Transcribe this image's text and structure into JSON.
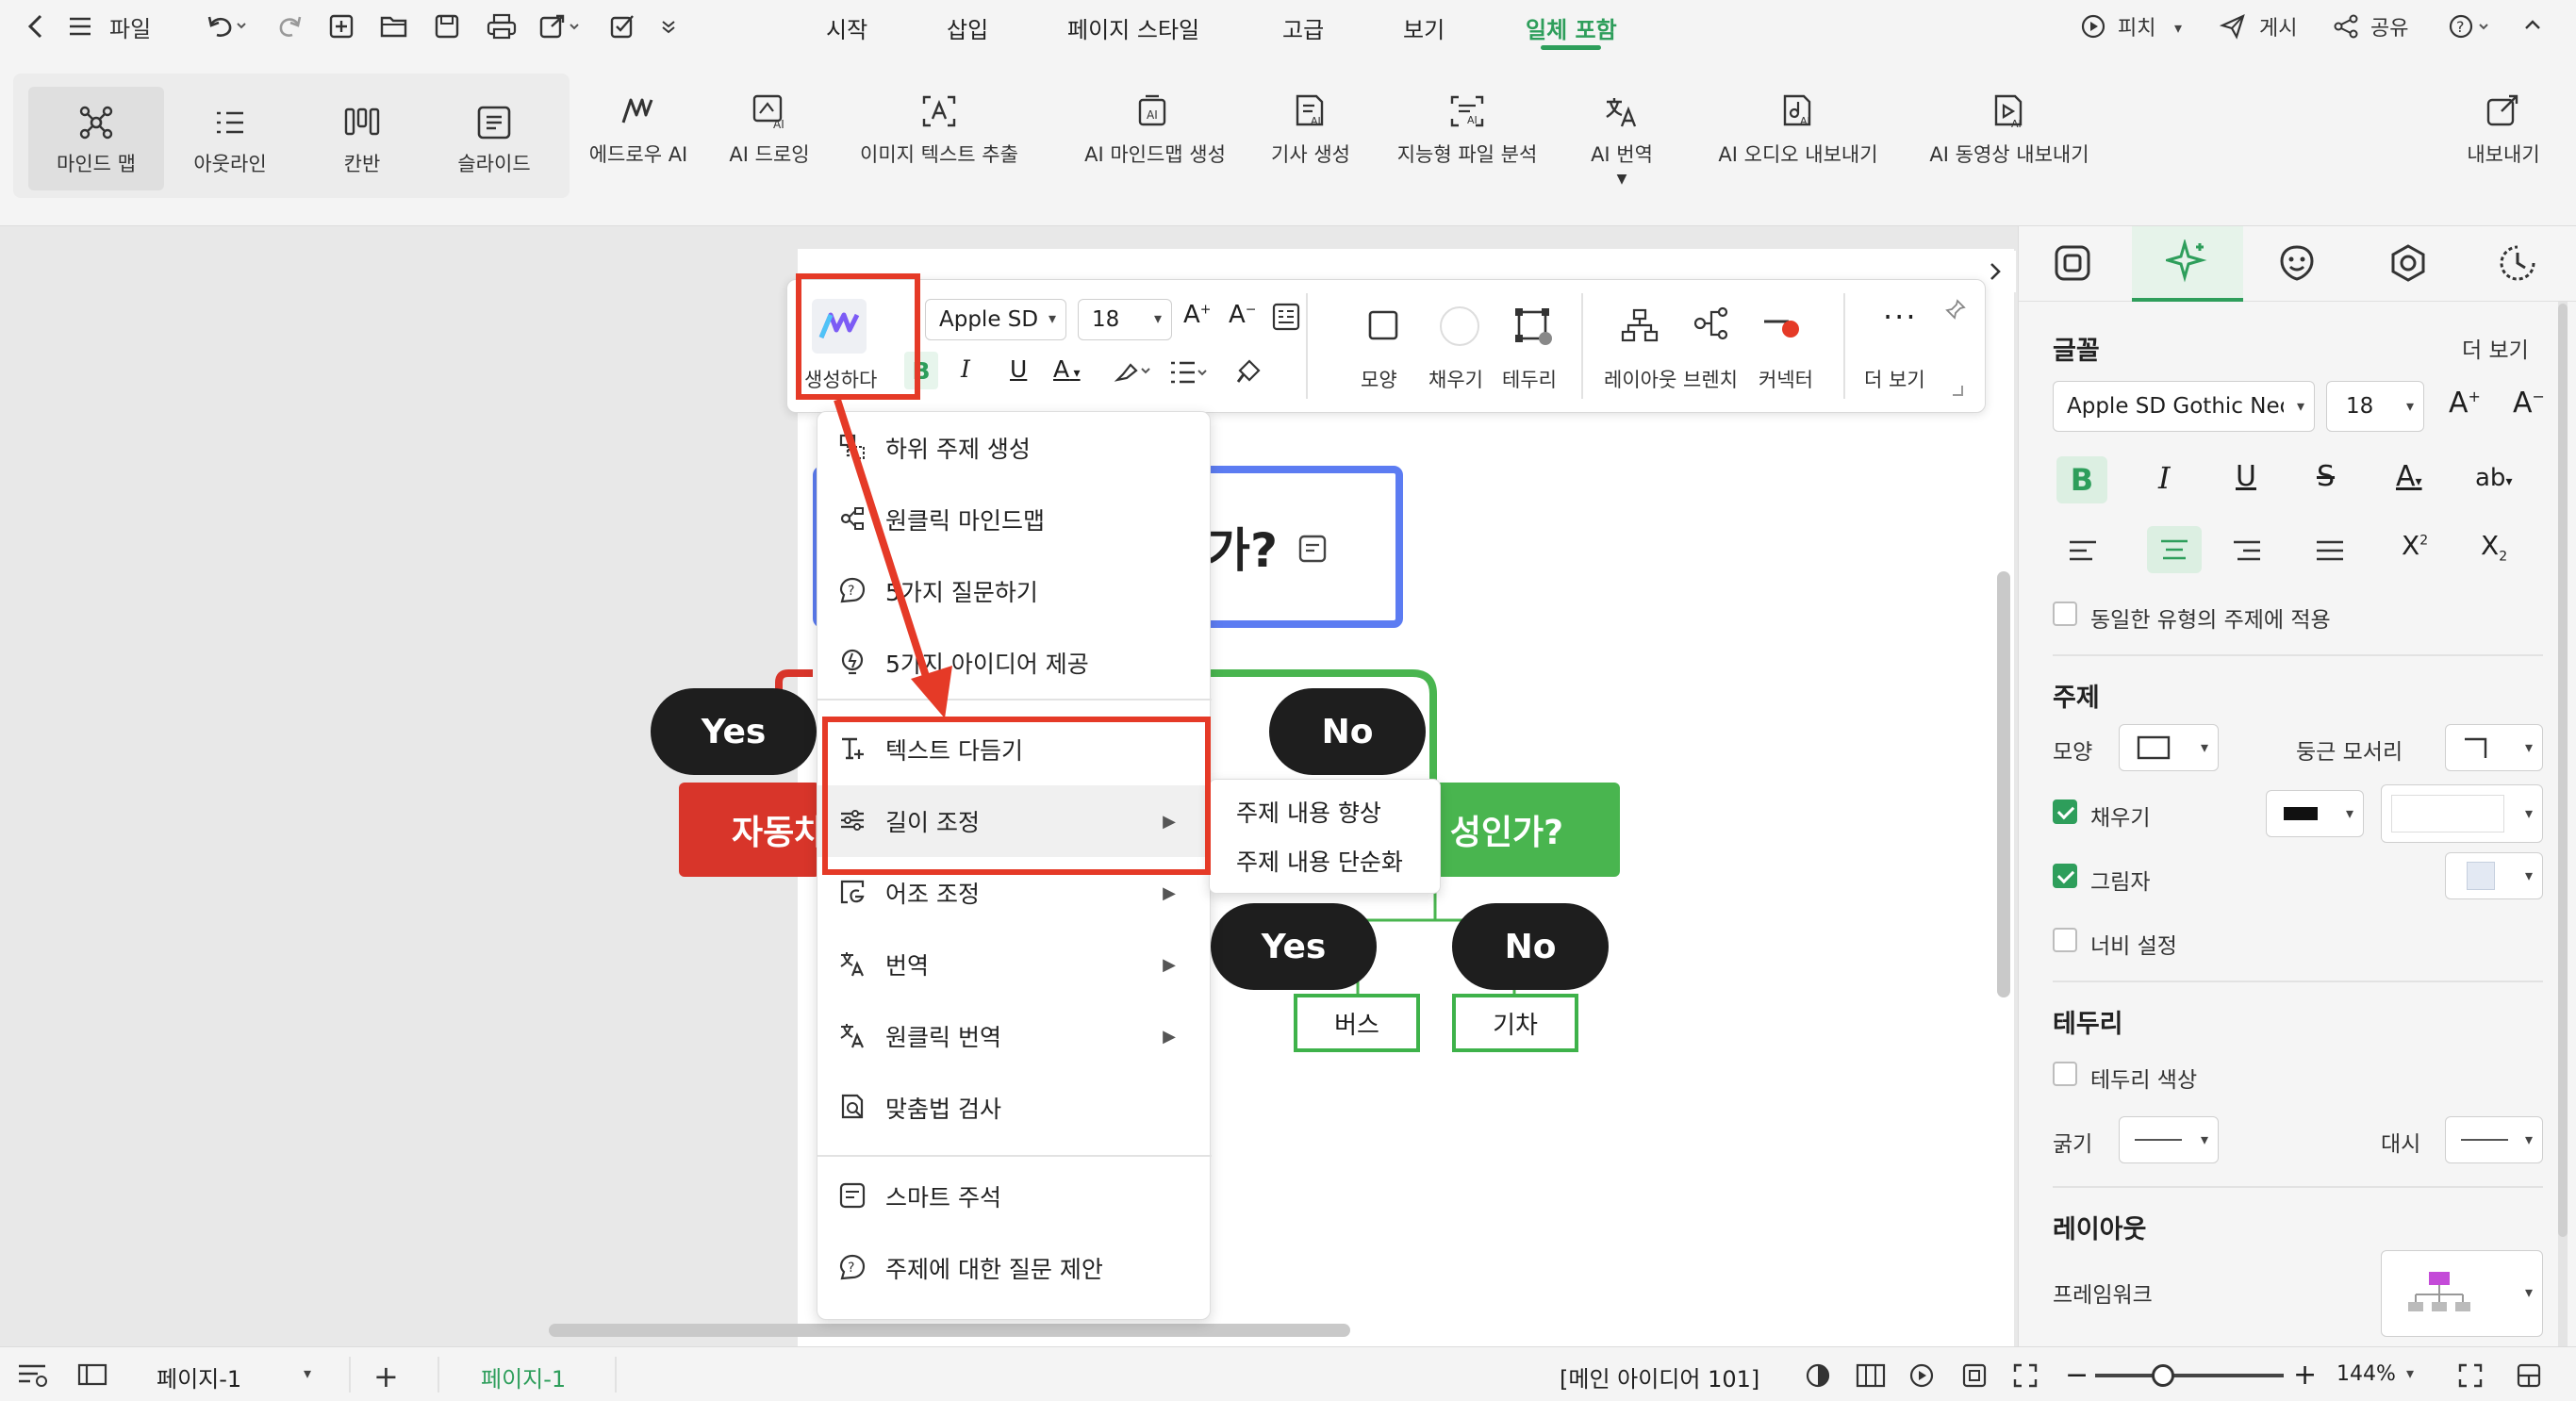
{
  "topbar": {
    "file": "파일",
    "menu_tabs": [
      {
        "label": "시작"
      },
      {
        "label": "삽입"
      },
      {
        "label": "페이지 스타일"
      },
      {
        "label": "고급"
      },
      {
        "label": "보기"
      },
      {
        "label": "일체 포함"
      }
    ],
    "active_tab": "일체 포함",
    "pitch": "피치",
    "publish": "게시",
    "share": "공유"
  },
  "ribbon": {
    "view_buttons": [
      {
        "label": "마인드 맵",
        "icon": "mindmap-icon"
      },
      {
        "label": "아웃라인",
        "icon": "outline-icon"
      },
      {
        "label": "칸반",
        "icon": "kanban-icon"
      },
      {
        "label": "슬라이드",
        "icon": "slide-icon"
      }
    ],
    "ai_buttons": [
      {
        "label": "에드로우 AI",
        "icon": "edraw-ai-icon"
      },
      {
        "label": "AI 드로잉",
        "icon": "ai-drawing-icon"
      },
      {
        "label": "이미지 텍스트 추출",
        "icon": "image-text-extract-icon"
      },
      {
        "label": "AI 마인드맵 생성",
        "icon": "ai-mindmap-icon"
      },
      {
        "label": "기사 생성",
        "icon": "article-generate-icon"
      },
      {
        "label": "지능형 파일 분석",
        "icon": "file-analysis-icon"
      },
      {
        "label": "AI 번역",
        "icon": "ai-translate-icon"
      },
      {
        "label": "AI 오디오 내보내기",
        "icon": "ai-audio-export-icon"
      },
      {
        "label": "AI 동영상 내보내기",
        "icon": "ai-video-export-icon"
      }
    ],
    "export": "내보내기"
  },
  "floating_toolbar": {
    "generate": "생성하다",
    "font": "Apple SD",
    "size": "18",
    "shape": "모양",
    "fill": "채우기",
    "border": "테두리",
    "layout": "레이아웃",
    "branch": "브렌치",
    "connector": "커넥터",
    "more": "더 보기"
  },
  "context_menu": {
    "items": [
      {
        "label": "하위 주제 생성",
        "icon": "subtopic-icon"
      },
      {
        "label": "원클릭 마인드맵",
        "icon": "mindmap-oneclick-icon"
      },
      {
        "label": "5가지 질문하기",
        "icon": "question-icon"
      },
      {
        "label": "5가지 아이디어 제공",
        "icon": "idea-icon"
      },
      {
        "label": "텍스트 다듬기",
        "icon": "text-polish-icon"
      },
      {
        "label": "길이 조정",
        "icon": "length-adjust-icon"
      },
      {
        "label": "어조 조정",
        "icon": "tone-adjust-icon"
      },
      {
        "label": "번역",
        "icon": "translate-icon"
      },
      {
        "label": "원클릭 번역",
        "icon": "oneclick-translate-icon"
      },
      {
        "label": "맞춤법 검사",
        "icon": "spellcheck-icon"
      },
      {
        "label": "스마트 주석",
        "icon": "smart-note-icon"
      },
      {
        "label": "주제에 대한 질문 제안",
        "icon": "question-suggest-icon"
      }
    ]
  },
  "submenu": {
    "items": [
      "주제 내용 향상",
      "주제 내용 단순화"
    ]
  },
  "canvas": {
    "topic_fragment": "가?",
    "yes": "Yes",
    "no": "No",
    "red_topic": "자동차",
    "green_topic": "성인가?",
    "yes2": "Yes",
    "no2": "No",
    "bus": "버스",
    "train": "기차"
  },
  "right_panel": {
    "font_section": "글꼴",
    "more": "더 보기",
    "font_name": "Apple SD Gothic Neo",
    "font_size": "18",
    "same_type": "동일한 유형의 주제에 적용",
    "topic_section": "주제",
    "shape": "모양",
    "rounded": "둥근 모서리",
    "fill": "채우기",
    "shadow": "그림자",
    "width": "너비 설정",
    "border_section": "테두리",
    "border_color": "테두리 색상",
    "thickness": "굵기",
    "dash": "대시",
    "layout_section": "레이아웃",
    "framework": "프레임워크"
  },
  "status": {
    "page_select": "페이지-1",
    "page_tab": "페이지-1",
    "main_idea": "[메인 아이디어 101]",
    "zoom": "144%"
  },
  "colors": {
    "accent": "#2e9e5b",
    "highlight": "#e53a27",
    "topic_red": "#d8352a",
    "topic_green": "#49b54f",
    "topic_blue": "#5c7cf2",
    "pill": "#1e1e1e"
  }
}
